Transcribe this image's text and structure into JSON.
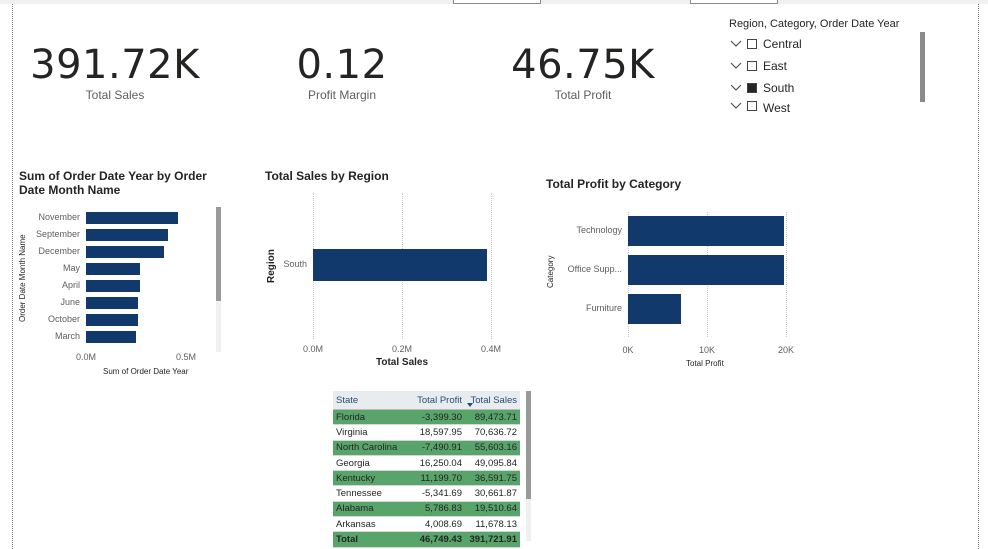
{
  "kpis": [
    {
      "value": "391.72K",
      "label": "Total Sales"
    },
    {
      "value": "0.12",
      "label": "Profit Margin"
    },
    {
      "value": "46.75K",
      "label": "Total Profit"
    }
  ],
  "slicer": {
    "title": "Region, Category, Order Date Year",
    "items": [
      {
        "label": "Central",
        "checked": false
      },
      {
        "label": "East",
        "checked": false
      },
      {
        "label": "South",
        "checked": true
      },
      {
        "label": "West",
        "checked": false
      }
    ]
  },
  "chart_data": [
    {
      "type": "bar",
      "orientation": "horizontal",
      "title": "Sum of Order Date Year by Order Date Month Name",
      "xlabel": "Sum of Order Date Year",
      "ylabel": "Order Date Month Name",
      "categories": [
        "November",
        "September",
        "December",
        "May",
        "April",
        "June",
        "October",
        "March"
      ],
      "values": [
        0.46,
        0.41,
        0.39,
        0.27,
        0.27,
        0.26,
        0.26,
        0.25
      ],
      "unit": "M",
      "xlim": [
        0,
        0.5
      ],
      "xticks": [
        "0.0M",
        "0.5M"
      ],
      "color": "#12396b"
    },
    {
      "type": "bar",
      "orientation": "horizontal",
      "title": "Total Sales by Region",
      "xlabel": "Total Sales",
      "ylabel": "Region",
      "categories": [
        "South"
      ],
      "values": [
        0.39172
      ],
      "unit": "M",
      "xlim": [
        0,
        0.4
      ],
      "xticks": [
        "0.0M",
        "0.2M",
        "0.4M"
      ],
      "grid": true,
      "color": "#12396b"
    },
    {
      "type": "bar",
      "orientation": "horizontal",
      "title": "Total Profit by Category",
      "xlabel": "Total Profit",
      "ylabel": "Category",
      "categories": [
        "Technology",
        "Office Supp...",
        "Furniture"
      ],
      "values": [
        19.8,
        19.8,
        6.7
      ],
      "unit": "K",
      "xlim": [
        0,
        20
      ],
      "xticks": [
        "0K",
        "10K",
        "20K"
      ],
      "grid": true,
      "color": "#12396b"
    }
  ],
  "table": {
    "headers": [
      "State",
      "Total Profit",
      "Total Sales"
    ],
    "rows": [
      [
        "Florida",
        "-3,399.30",
        "89,473.71"
      ],
      [
        "Virginia",
        "18,597.95",
        "70,636.72"
      ],
      [
        "North Carolina",
        "-7,490.91",
        "55,603.16"
      ],
      [
        "Georgia",
        "16,250.04",
        "49,095.84"
      ],
      [
        "Kentucky",
        "11,199.70",
        "36,591.75"
      ],
      [
        "Tennessee",
        "-5,341.69",
        "30,661.87"
      ],
      [
        "Alabama",
        "5,786.83",
        "19,510.64"
      ],
      [
        "Arkansas",
        "4,008.69",
        "11,678.13"
      ]
    ],
    "total": [
      "Total",
      "46,749.43",
      "391,721.91"
    ]
  }
}
